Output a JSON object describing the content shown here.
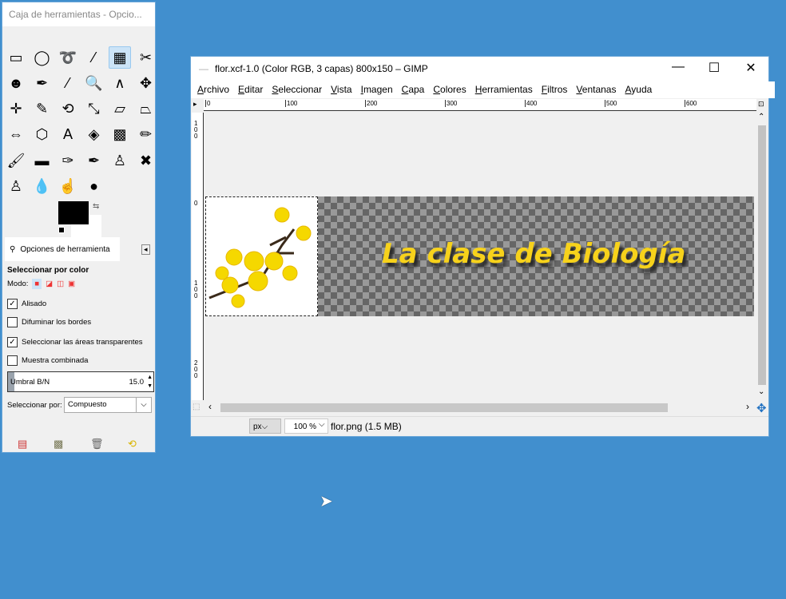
{
  "toolbox": {
    "title": "Caja de herramientas - Opcio...",
    "tools": [
      {
        "name": "rect-select",
        "glyph": "▭"
      },
      {
        "name": "ellipse-select",
        "glyph": "◯"
      },
      {
        "name": "free-select",
        "glyph": "➰"
      },
      {
        "name": "fuzzy-select",
        "glyph": "⁄"
      },
      {
        "name": "select-by-color",
        "glyph": "▦"
      },
      {
        "name": "scissors",
        "glyph": "✂"
      },
      {
        "name": "foreground-select",
        "glyph": "☻"
      },
      {
        "name": "paths",
        "glyph": "✒"
      },
      {
        "name": "color-picker",
        "glyph": "⁄"
      },
      {
        "name": "zoom",
        "glyph": "🔍"
      },
      {
        "name": "measure",
        "glyph": "∧"
      },
      {
        "name": "move",
        "glyph": "✥"
      },
      {
        "name": "align",
        "glyph": "✛"
      },
      {
        "name": "crop",
        "glyph": "✎"
      },
      {
        "name": "rotate",
        "glyph": "⟲"
      },
      {
        "name": "scale",
        "glyph": "⤡"
      },
      {
        "name": "shear",
        "glyph": "▱"
      },
      {
        "name": "perspective",
        "glyph": "⏢"
      },
      {
        "name": "flip",
        "glyph": "⇔"
      },
      {
        "name": "cage-transform",
        "glyph": "⬡"
      },
      {
        "name": "text",
        "glyph": "A"
      },
      {
        "name": "bucket-fill",
        "glyph": "◈"
      },
      {
        "name": "blend",
        "glyph": "▩"
      },
      {
        "name": "pencil",
        "glyph": "✏"
      },
      {
        "name": "paintbrush",
        "glyph": "🖌"
      },
      {
        "name": "eraser",
        "glyph": "▬"
      },
      {
        "name": "airbrush",
        "glyph": "✑"
      },
      {
        "name": "ink",
        "glyph": "✒"
      },
      {
        "name": "clone",
        "glyph": "♙"
      },
      {
        "name": "heal",
        "glyph": "✖"
      },
      {
        "name": "perspective-clone",
        "glyph": "♙"
      },
      {
        "name": "blur",
        "glyph": "💧"
      },
      {
        "name": "smudge",
        "glyph": "☝"
      },
      {
        "name": "dodge-burn",
        "glyph": "●"
      }
    ]
  },
  "options": {
    "tab_label": "Opciones de herramienta",
    "heading": "Seleccionar por color",
    "mode_label": "Modo:",
    "checks": [
      {
        "label": "Alisado",
        "checked": true
      },
      {
        "label": "Difuminar los bordes",
        "checked": false
      },
      {
        "label": "Seleccionar las áreas transparentes",
        "checked": true
      },
      {
        "label": "Muestra combinada",
        "checked": false
      }
    ],
    "threshold_label": "Umbral B/N",
    "threshold_value": "15.0",
    "threshold_fraction": 0.06,
    "select_by_label": "Seleccionar por:",
    "select_by_value": "Compuesto"
  },
  "image_window": {
    "title": "flor.xcf-1.0 (Color RGB, 3 capas) 800x150 – GIMP",
    "menu": [
      "Archivo",
      "Editar",
      "Seleccionar",
      "Vista",
      "Imagen",
      "Capa",
      "Colores",
      "Herramientas",
      "Filtros",
      "Ventanas",
      "Ayuda"
    ],
    "ruler_ticks": [
      "0",
      "100",
      "200",
      "300",
      "400",
      "500",
      "600"
    ],
    "vruler_ticks": [
      "100",
      "0",
      "100",
      "200"
    ],
    "canvas_text": "La clase de Biología",
    "unit": "px",
    "zoom": "100 %",
    "status": "flor.png (1.5 MB)"
  }
}
